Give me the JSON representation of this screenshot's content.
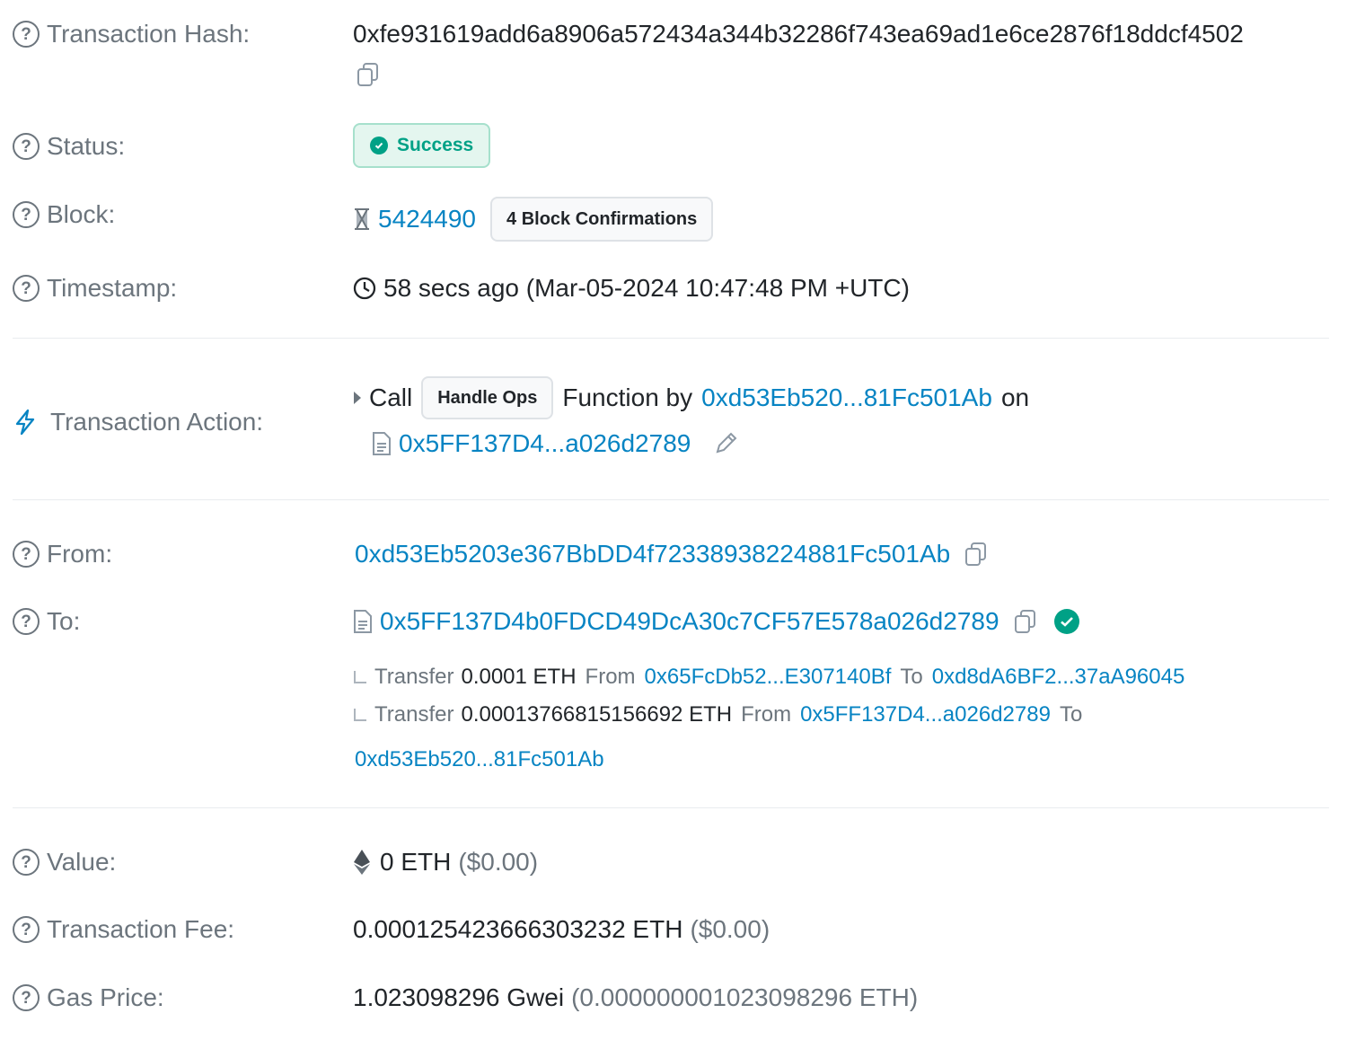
{
  "hash": {
    "label": "Transaction Hash:",
    "value": "0xfe931619add6a8906a572434a344b32286f743ea69ad1e6ce2876f18ddcf4502"
  },
  "status": {
    "label": "Status:",
    "badge": "Success"
  },
  "block": {
    "label": "Block:",
    "number": "5424490",
    "confirmations": "4 Block Confirmations"
  },
  "timestamp": {
    "label": "Timestamp:",
    "value": "58 secs ago (Mar-05-2024 10:47:48 PM +UTC)"
  },
  "action": {
    "label": "Transaction Action:",
    "call": "Call",
    "method": "Handle Ops",
    "function_by": "Function by",
    "caller": "0xd53Eb520...81Fc501Ab",
    "on": "on",
    "contract": "0x5FF137D4...a026d2789"
  },
  "from": {
    "label": "From:",
    "address": "0xd53Eb5203e367BbDD4f72338938224881Fc501Ab"
  },
  "to": {
    "label": "To:",
    "address": "0x5FF137D4b0FDCD49DcA30c7CF57E578a026d2789",
    "transfers": [
      {
        "word": "Transfer",
        "amount": "0.0001 ETH",
        "from_word": "From",
        "from": "0x65FcDb52...E307140Bf",
        "to_word": "To",
        "to": "0xd8dA6BF2...37aA96045"
      },
      {
        "word": "Transfer",
        "amount": "0.00013766815156692 ETH",
        "from_word": "From",
        "from": "0x5FF137D4...a026d2789",
        "to_word": "To",
        "to": "0xd53Eb520...81Fc501Ab"
      }
    ]
  },
  "value": {
    "label": "Value:",
    "amount": "0 ETH",
    "usd": "($0.00)"
  },
  "fee": {
    "label": "Transaction Fee:",
    "amount": "0.000125423666303232 ETH",
    "usd": "($0.00)"
  },
  "gas": {
    "label": "Gas Price:",
    "amount": "1.023098296 Gwei",
    "eth": "(0.000000001023098296 ETH)"
  },
  "colors": {
    "link": "#0784c3",
    "success": "#00a186",
    "muted": "#6c757d"
  },
  "icons": [
    "question-circle-icon",
    "copy-icon",
    "check-circle-icon",
    "hourglass-icon",
    "clock-icon",
    "lightning-icon",
    "caret-right-icon",
    "file-icon",
    "pencil-icon",
    "ethereum-icon",
    "corner-arrow-icon"
  ]
}
